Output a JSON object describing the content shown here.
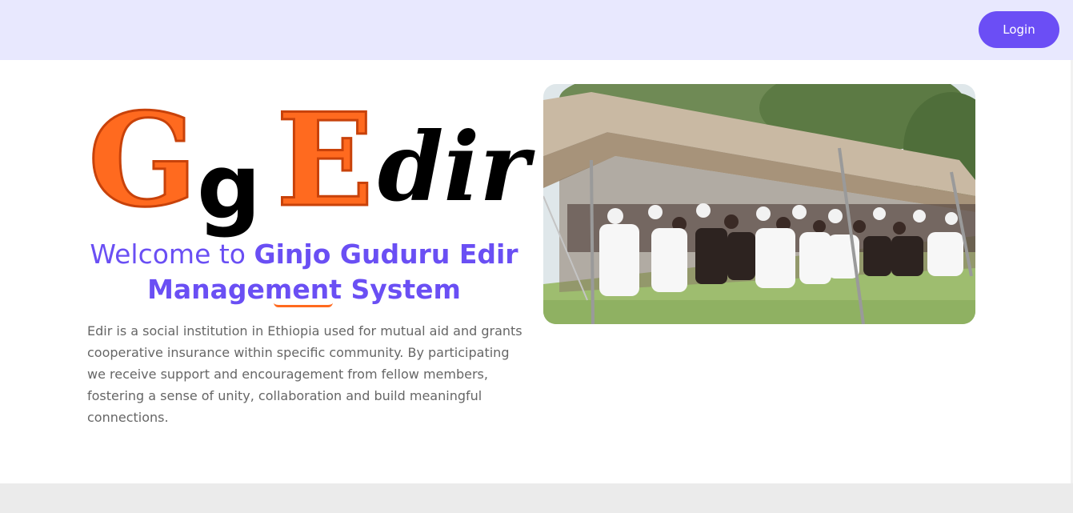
{
  "header": {
    "login_label": "Login",
    "accent_color": "#6b4ef5",
    "background_color": "#e8e8fe"
  },
  "logo": {
    "letter_G": "G",
    "letter_g": "g",
    "letter_E": "E",
    "letters_dir": "dir",
    "orange_color": "#ff6a1f",
    "black_color": "#000000"
  },
  "hero": {
    "welcome_prefix": "Welcome to",
    "welcome_name_line1": "Ginjo Guduru Edir",
    "welcome_name_line2": "Management System",
    "heading_color": "#6a4ff4",
    "description": "Edir is a social institution in Ethiopia used for mutual aid and grants cooperative insurance within specific community. By participating we receive support and encouragement from fellow members, fostering a sense of unity, collaboration and build meaningful connections."
  },
  "photo": {
    "icon": "community-gathering-photo"
  }
}
